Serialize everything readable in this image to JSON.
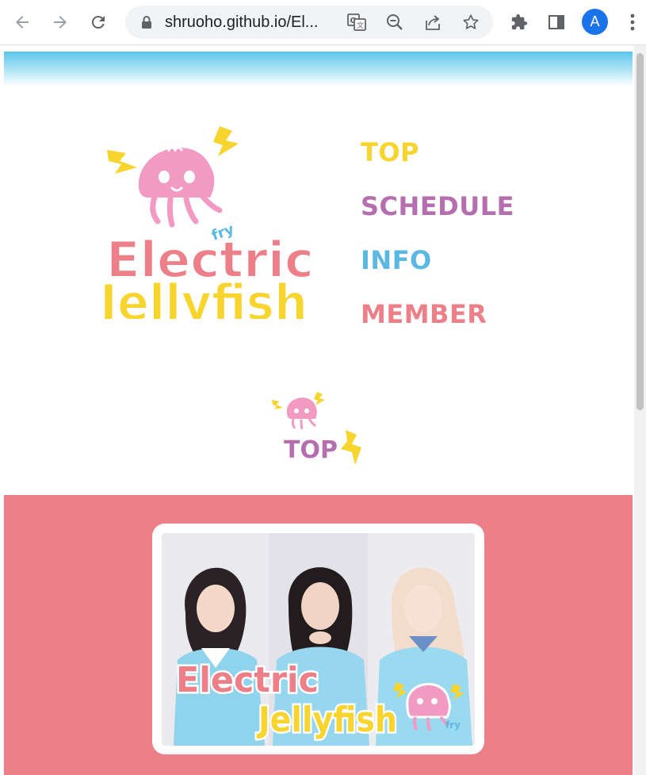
{
  "browser": {
    "url": "shruoho.github.io/El...",
    "avatar_letter": "A"
  },
  "site": {
    "menu": [
      {
        "label": "TOP",
        "color": "#f7d42e"
      },
      {
        "label": "SCHEDULE",
        "color": "#b56fae"
      },
      {
        "label": "INFO",
        "color": "#5ab8e2"
      },
      {
        "label": "MEMBER",
        "color": "#ec7f87"
      }
    ],
    "logo": {
      "line1": "Electric",
      "line2": "Jellyfish",
      "tag": "fry"
    },
    "section_title": "TOP",
    "hero_logo": {
      "line1": "Electric",
      "line2": "Jellyfish",
      "tag": "fry"
    },
    "colors": {
      "top_band": "#5ac6ea",
      "panel": "#ec7f87",
      "yellow": "#f7d42e",
      "purple": "#b56fae",
      "blue": "#5ab8e2",
      "pink": "#ec7f87"
    }
  }
}
